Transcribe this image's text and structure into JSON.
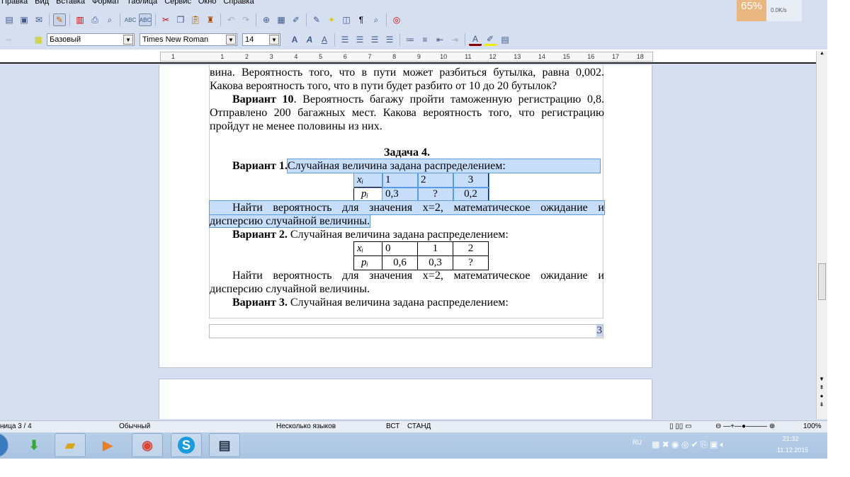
{
  "menu": [
    "Правка",
    "Вид",
    "Вставка",
    "Формат",
    "Таблица",
    "Сервис",
    "Окно",
    "Справка"
  ],
  "formatting": {
    "style": "Базовый",
    "font": "Times New Roman",
    "size": "14"
  },
  "overlay": {
    "percent": "65%",
    "speed": "0.0K/s"
  },
  "ruler": [
    "1",
    "",
    "1",
    "2",
    "3",
    "4",
    "5",
    "6",
    "7",
    "8",
    "9",
    "10",
    "11",
    "12",
    "13",
    "14",
    "15",
    "16",
    "17",
    "18"
  ],
  "document": {
    "lines": [
      "вина. Вероятность того, что в пути может разбиться бутылка, равна 0,002.",
      "Какова вероятность того, что в пути будет разбито от 10 до 20 бутылок?"
    ],
    "v10_bold": "Вариант 10",
    "v10_line1": ". Вероятность багажу пройти таможенную регистрацию 0,8.",
    "v10_line2": "Отправлено 200 багажных мест. Какова вероятность того, что регистрацию",
    "v10_line3": "пройдут не менее половины из них.",
    "task_title": "Задача 4.",
    "v1_bold": "Вариант 1.",
    "v1_text": " Случайная величина задана распределением:",
    "table1": {
      "x_label": "xᵢ",
      "p_label": "pᵢ",
      "x": [
        "1",
        "2",
        "3"
      ],
      "p": [
        "0,3",
        "?",
        "0,2"
      ]
    },
    "find1_line1": "Найти вероятность для значения x=2, математическое ожидание и",
    "find1_line2": "дисперсию случайной величины.",
    "v2_bold": "Вариант 2.",
    "v2_text": " Случайная величина задана распределением:",
    "table2": {
      "x_label": "xᵢ",
      "p_label": "pᵢ",
      "x": [
        "0",
        "1",
        "2"
      ],
      "p": [
        "0,6",
        "0,3",
        "?"
      ]
    },
    "find2_line1": "Найти вероятность для значения x=2, математическое ожидание и",
    "find2_line2": "дисперсию случайной величины.",
    "v3_bold": "Вариант 3.",
    "v3_text": " Случайная величина задана распределением:",
    "page_number": "3"
  },
  "status": {
    "page": "ница 3 / 4",
    "style": "Обычный",
    "language": "Несколько языков",
    "insert": "ВСТ",
    "select": "СТАНД",
    "zoom": "100%"
  },
  "tray": {
    "lang": "RU",
    "time": "21:32",
    "date": "11.12.2015"
  }
}
